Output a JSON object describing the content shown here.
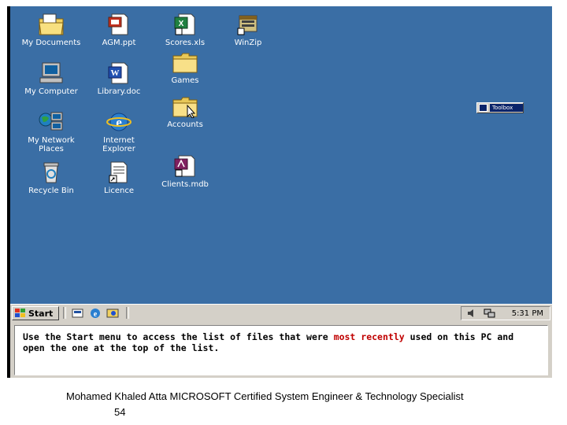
{
  "desktop": {
    "icons": [
      {
        "id": "my-documents",
        "label": "My Documents",
        "icon": "folder-documents-icon"
      },
      {
        "id": "agm-ppt",
        "label": "AGM.ppt",
        "icon": "powerpoint-file-icon"
      },
      {
        "id": "scores-xls",
        "label": "Scores.xls",
        "icon": "excel-file-icon"
      },
      {
        "id": "winzip",
        "label": "WinZip",
        "icon": "winzip-icon"
      },
      {
        "id": "games",
        "label": "Games",
        "icon": "folder-icon"
      },
      {
        "id": "my-computer",
        "label": "My Computer",
        "icon": "computer-icon"
      },
      {
        "id": "library-doc",
        "label": "Library.doc",
        "icon": "word-file-icon"
      },
      {
        "id": "accounts",
        "label": "Accounts",
        "icon": "folder-icon"
      },
      {
        "id": "my-network",
        "label": "My Network Places",
        "label_line1": "My Network",
        "label_line2": "Places",
        "icon": "network-icon"
      },
      {
        "id": "internet-explorer",
        "label": "Internet Explorer",
        "label_line1": "Internet",
        "label_line2": "Explorer",
        "icon": "internet-explorer-icon"
      },
      {
        "id": "recycle-bin",
        "label": "Recycle Bin",
        "icon": "recycle-bin-icon"
      },
      {
        "id": "licence",
        "label": "Licence",
        "icon": "document-shortcut-icon"
      },
      {
        "id": "clients-mdb",
        "label": "Clients.mdb",
        "icon": "access-file-icon"
      }
    ],
    "toolbox_title": "Toolbox"
  },
  "taskbar": {
    "start_label": "Start",
    "quick_launch": [
      "desktop-icon",
      "internet-explorer-icon",
      "outlook-icon"
    ],
    "tray_icons": [
      "speaker-icon",
      "network-tray-icon"
    ],
    "clock": "5:31 PM"
  },
  "message": {
    "before": "Use the Start menu to access the list of files that were ",
    "highlight": "most recently",
    "after": " used on this PC and open the one at the top of the list."
  },
  "footer": {
    "credit": "Mohamed Khaled Atta MICROSOFT Certified System Engineer & Technology Specialist",
    "page_number": "54"
  },
  "colors": {
    "desktop": "#3a6ea5",
    "highlight": "#c00000"
  }
}
